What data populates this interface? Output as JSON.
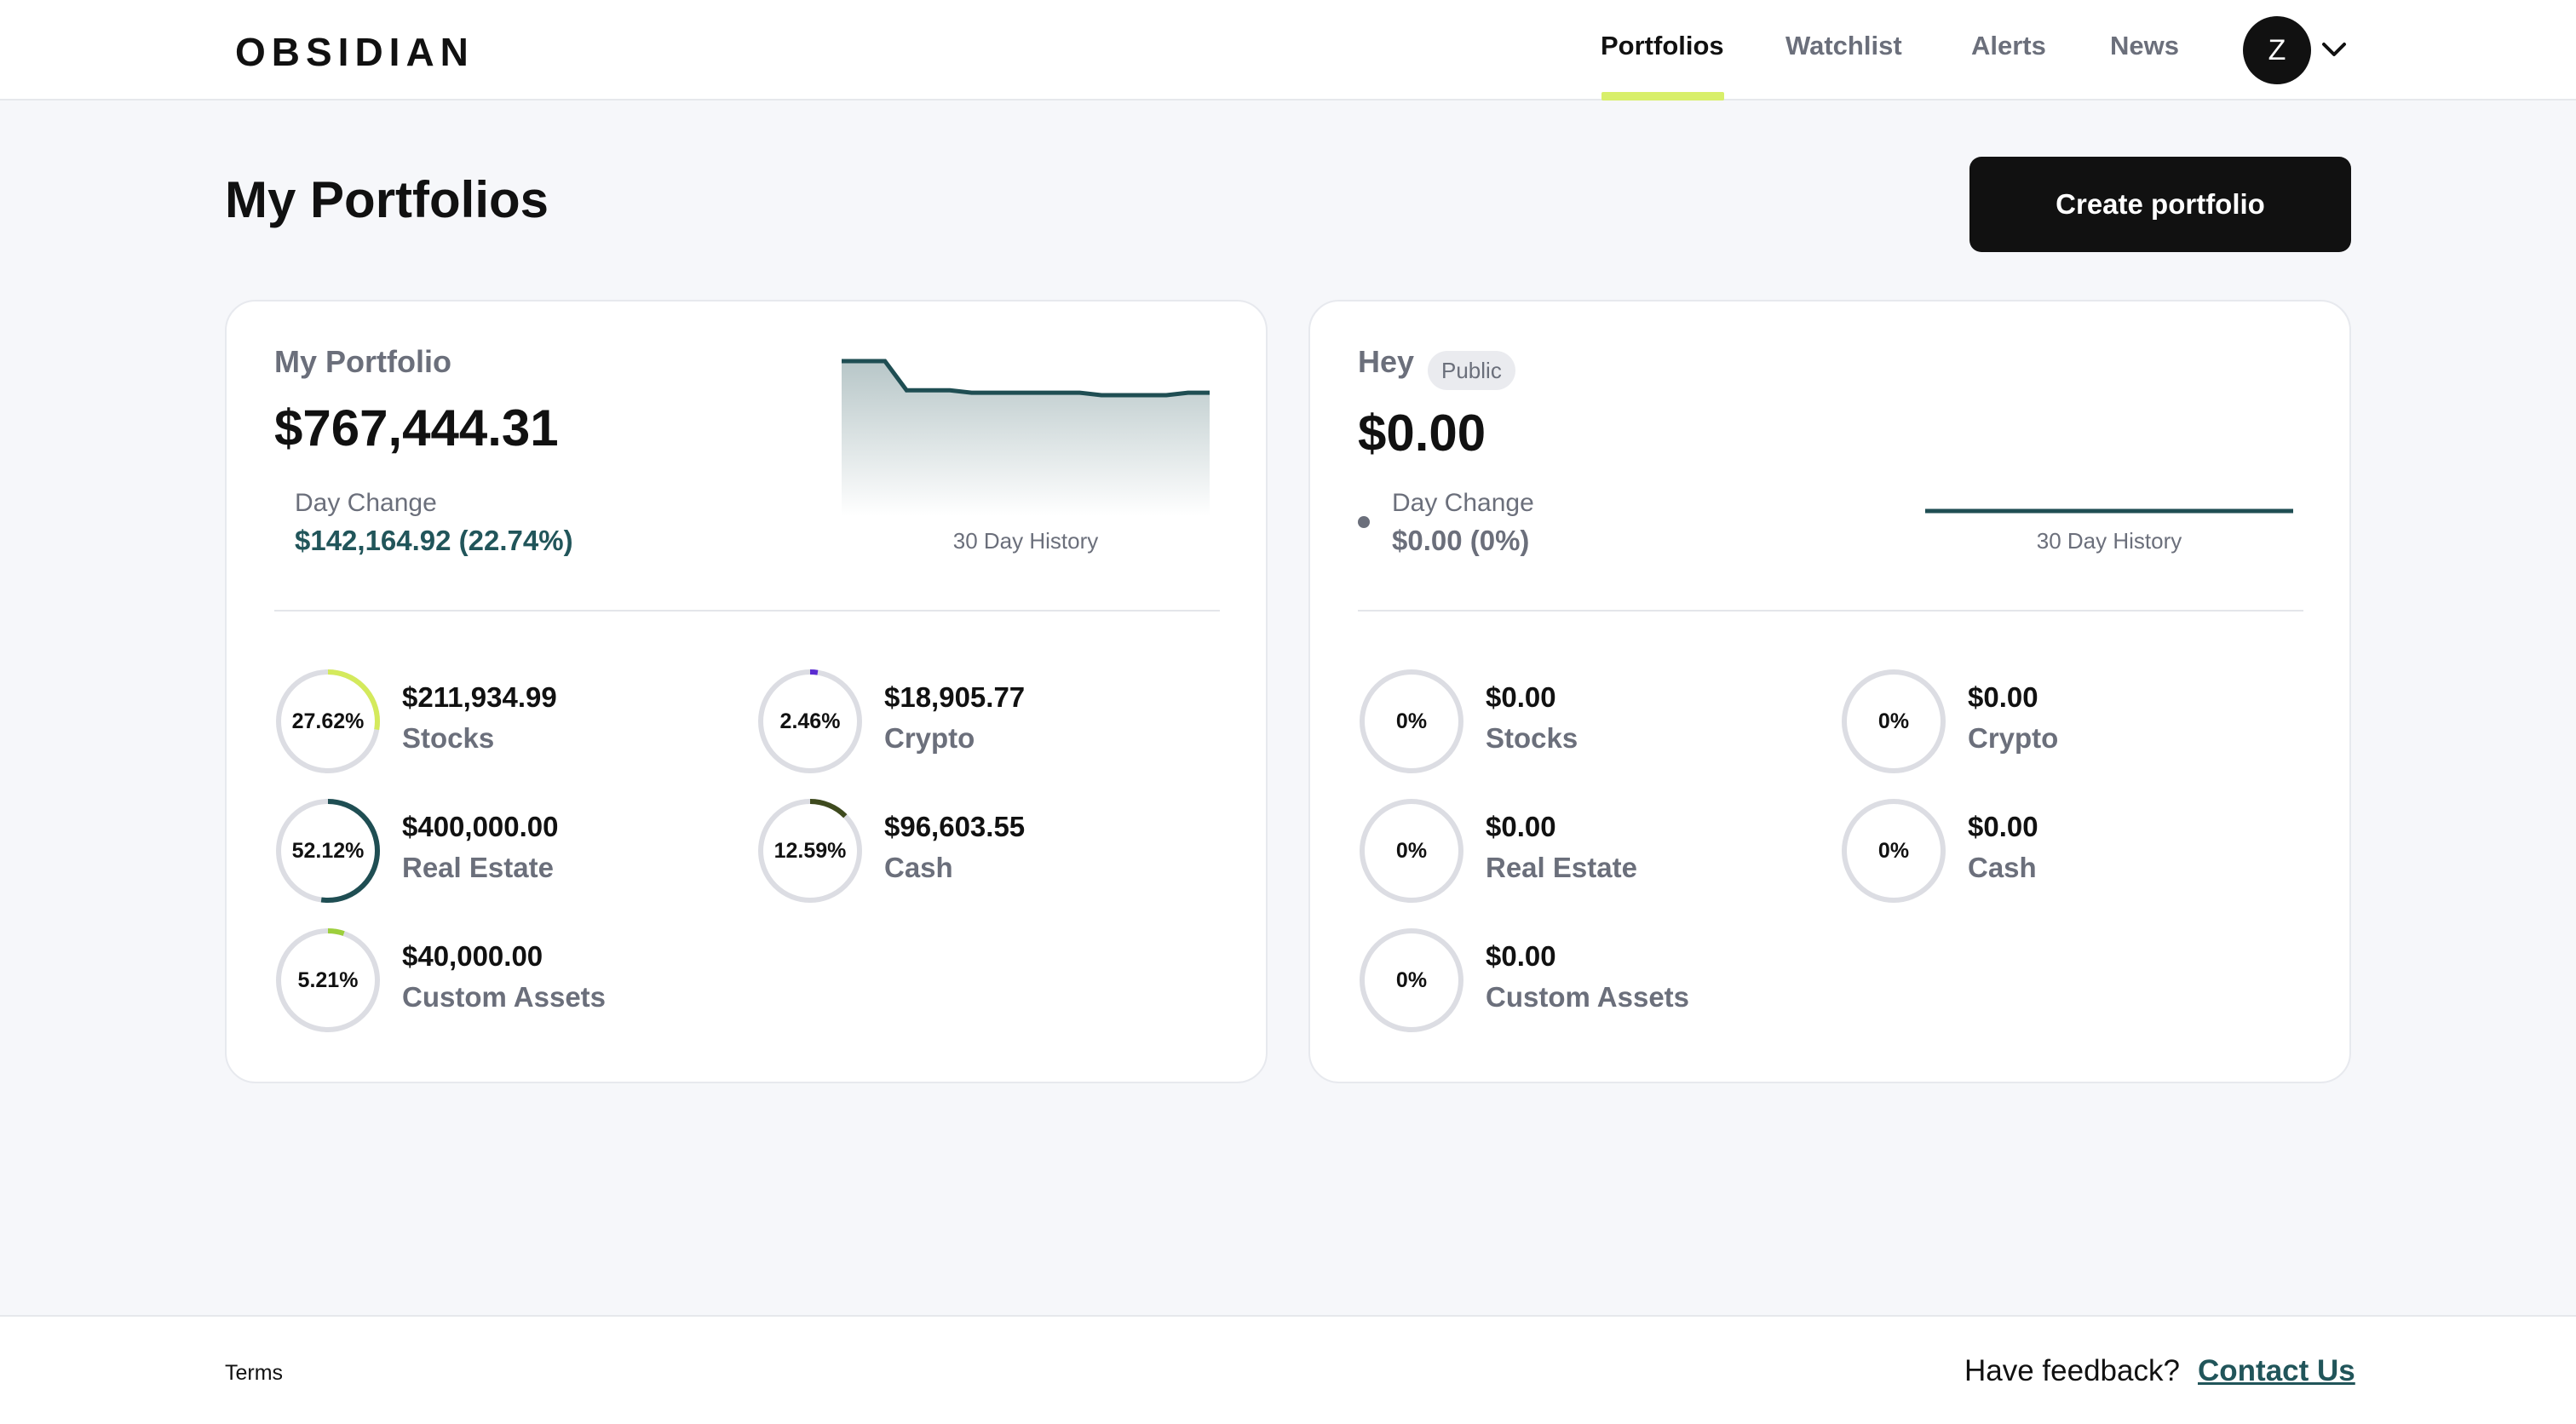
{
  "header": {
    "logo": "OBSIDIAN",
    "nav": [
      {
        "label": "Portfolios",
        "active": true
      },
      {
        "label": "Watchlist",
        "active": false
      },
      {
        "label": "Alerts",
        "active": false
      },
      {
        "label": "News",
        "active": false
      }
    ],
    "user_initial": "Z",
    "accent_color": "#d8ef6a"
  },
  "page": {
    "title": "My Portfolios",
    "create_button": "Create portfolio"
  },
  "portfolios": [
    {
      "name": "My Portfolio",
      "badge": "",
      "value": "$767,444.31",
      "day_change_label": "Day Change",
      "day_change_value": "$142,164.92 (22.74%)",
      "day_change_color": "#21555a",
      "history_label": "30 Day History",
      "history_points": [
        100,
        100,
        100,
        88,
        88,
        88,
        87,
        87,
        87,
        87,
        87,
        87,
        86,
        86,
        86,
        86,
        87,
        87
      ],
      "assets": [
        {
          "pct_label": "27.62%",
          "pct": 27.62,
          "amount": "$211,934.99",
          "label": "Stocks",
          "color": "#d4ea5c",
          "start": 0
        },
        {
          "pct_label": "2.46%",
          "pct": 2.46,
          "amount": "$18,905.77",
          "label": "Crypto",
          "color": "#5a2bd1",
          "start": 0
        },
        {
          "pct_label": "52.12%",
          "pct": 52.12,
          "amount": "$400,000.00",
          "label": "Real Estate",
          "color": "#1f4e53",
          "start": 0
        },
        {
          "pct_label": "12.59%",
          "pct": 12.59,
          "amount": "$96,603.55",
          "label": "Cash",
          "color": "#3e4a1e",
          "start": 0
        },
        {
          "pct_label": "5.21%",
          "pct": 5.21,
          "amount": "$40,000.00",
          "label": "Custom Assets",
          "color": "#9dcf3c",
          "start": 0
        }
      ]
    },
    {
      "name": "Hey",
      "badge": "Public",
      "value": "$0.00",
      "day_change_label": "Day Change",
      "day_change_value": "$0.00 (0%)",
      "day_change_color": "#6b6f7b",
      "history_label": "30 Day History",
      "history_points": [
        0,
        0
      ],
      "assets": [
        {
          "pct_label": "0%",
          "pct": 0,
          "amount": "$0.00",
          "label": "Stocks",
          "color": "#d4ea5c",
          "start": 0
        },
        {
          "pct_label": "0%",
          "pct": 0,
          "amount": "$0.00",
          "label": "Crypto",
          "color": "#5a2bd1",
          "start": 0
        },
        {
          "pct_label": "0%",
          "pct": 0,
          "amount": "$0.00",
          "label": "Real Estate",
          "color": "#1f4e53",
          "start": 0
        },
        {
          "pct_label": "0%",
          "pct": 0,
          "amount": "$0.00",
          "label": "Cash",
          "color": "#3e4a1e",
          "start": 0
        },
        {
          "pct_label": "0%",
          "pct": 0,
          "amount": "$0.00",
          "label": "Custom Assets",
          "color": "#9dcf3c",
          "start": 0
        }
      ]
    }
  ],
  "footer": {
    "terms": "Terms",
    "feedback": "Have feedback?",
    "contact": "Contact Us"
  }
}
